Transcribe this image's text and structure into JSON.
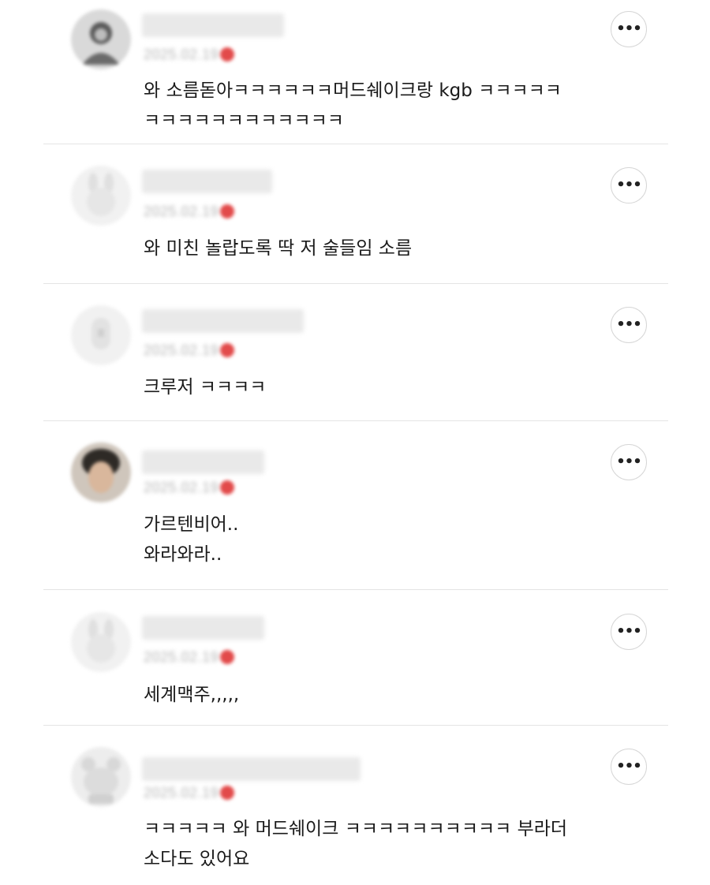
{
  "more_label": "•••",
  "comments": [
    {
      "date": "2025.02.19",
      "avatar": "avatar-sketch-icon",
      "lines": [
        "와 소름돋아ㅋㅋㅋㅋㅋㅋ머드쉐이크랑 kgb ㅋㅋㅋㅋㅋ",
        "ㅋㅋㅋㅋㅋㅋㅋㅋㅋㅋㅋㅋ"
      ]
    },
    {
      "date": "2025.02.19",
      "avatar": "avatar-bunny-icon",
      "lines": [
        "와 미친 놀랍도록 딱 저 술들임 소름"
      ]
    },
    {
      "date": "2025.02.19",
      "avatar": "avatar-bottle-icon",
      "lines": [
        "크루저 ㅋㅋㅋㅋ"
      ]
    },
    {
      "date": "2025.02.19",
      "avatar": "avatar-photo-icon",
      "lines": [
        "가르텐비어..",
        "와라와라.."
      ]
    },
    {
      "date": "2025.02.19",
      "avatar": "avatar-bunny-icon",
      "lines": [
        "세계맥주,,,,,"
      ]
    },
    {
      "date": "2025.02.19",
      "avatar": "avatar-bear-icon",
      "lines": [
        "ㅋㅋㅋㅋㅋ 와 머드쉐이크 ㅋㅋㅋㅋㅋㅋㅋㅋㅋㅋ 부라더",
        "소다도 있어요"
      ]
    }
  ],
  "colors": {
    "date_dot": "#e24a4a",
    "divider": "#e4e4e4",
    "text": "#1a1a1a"
  }
}
